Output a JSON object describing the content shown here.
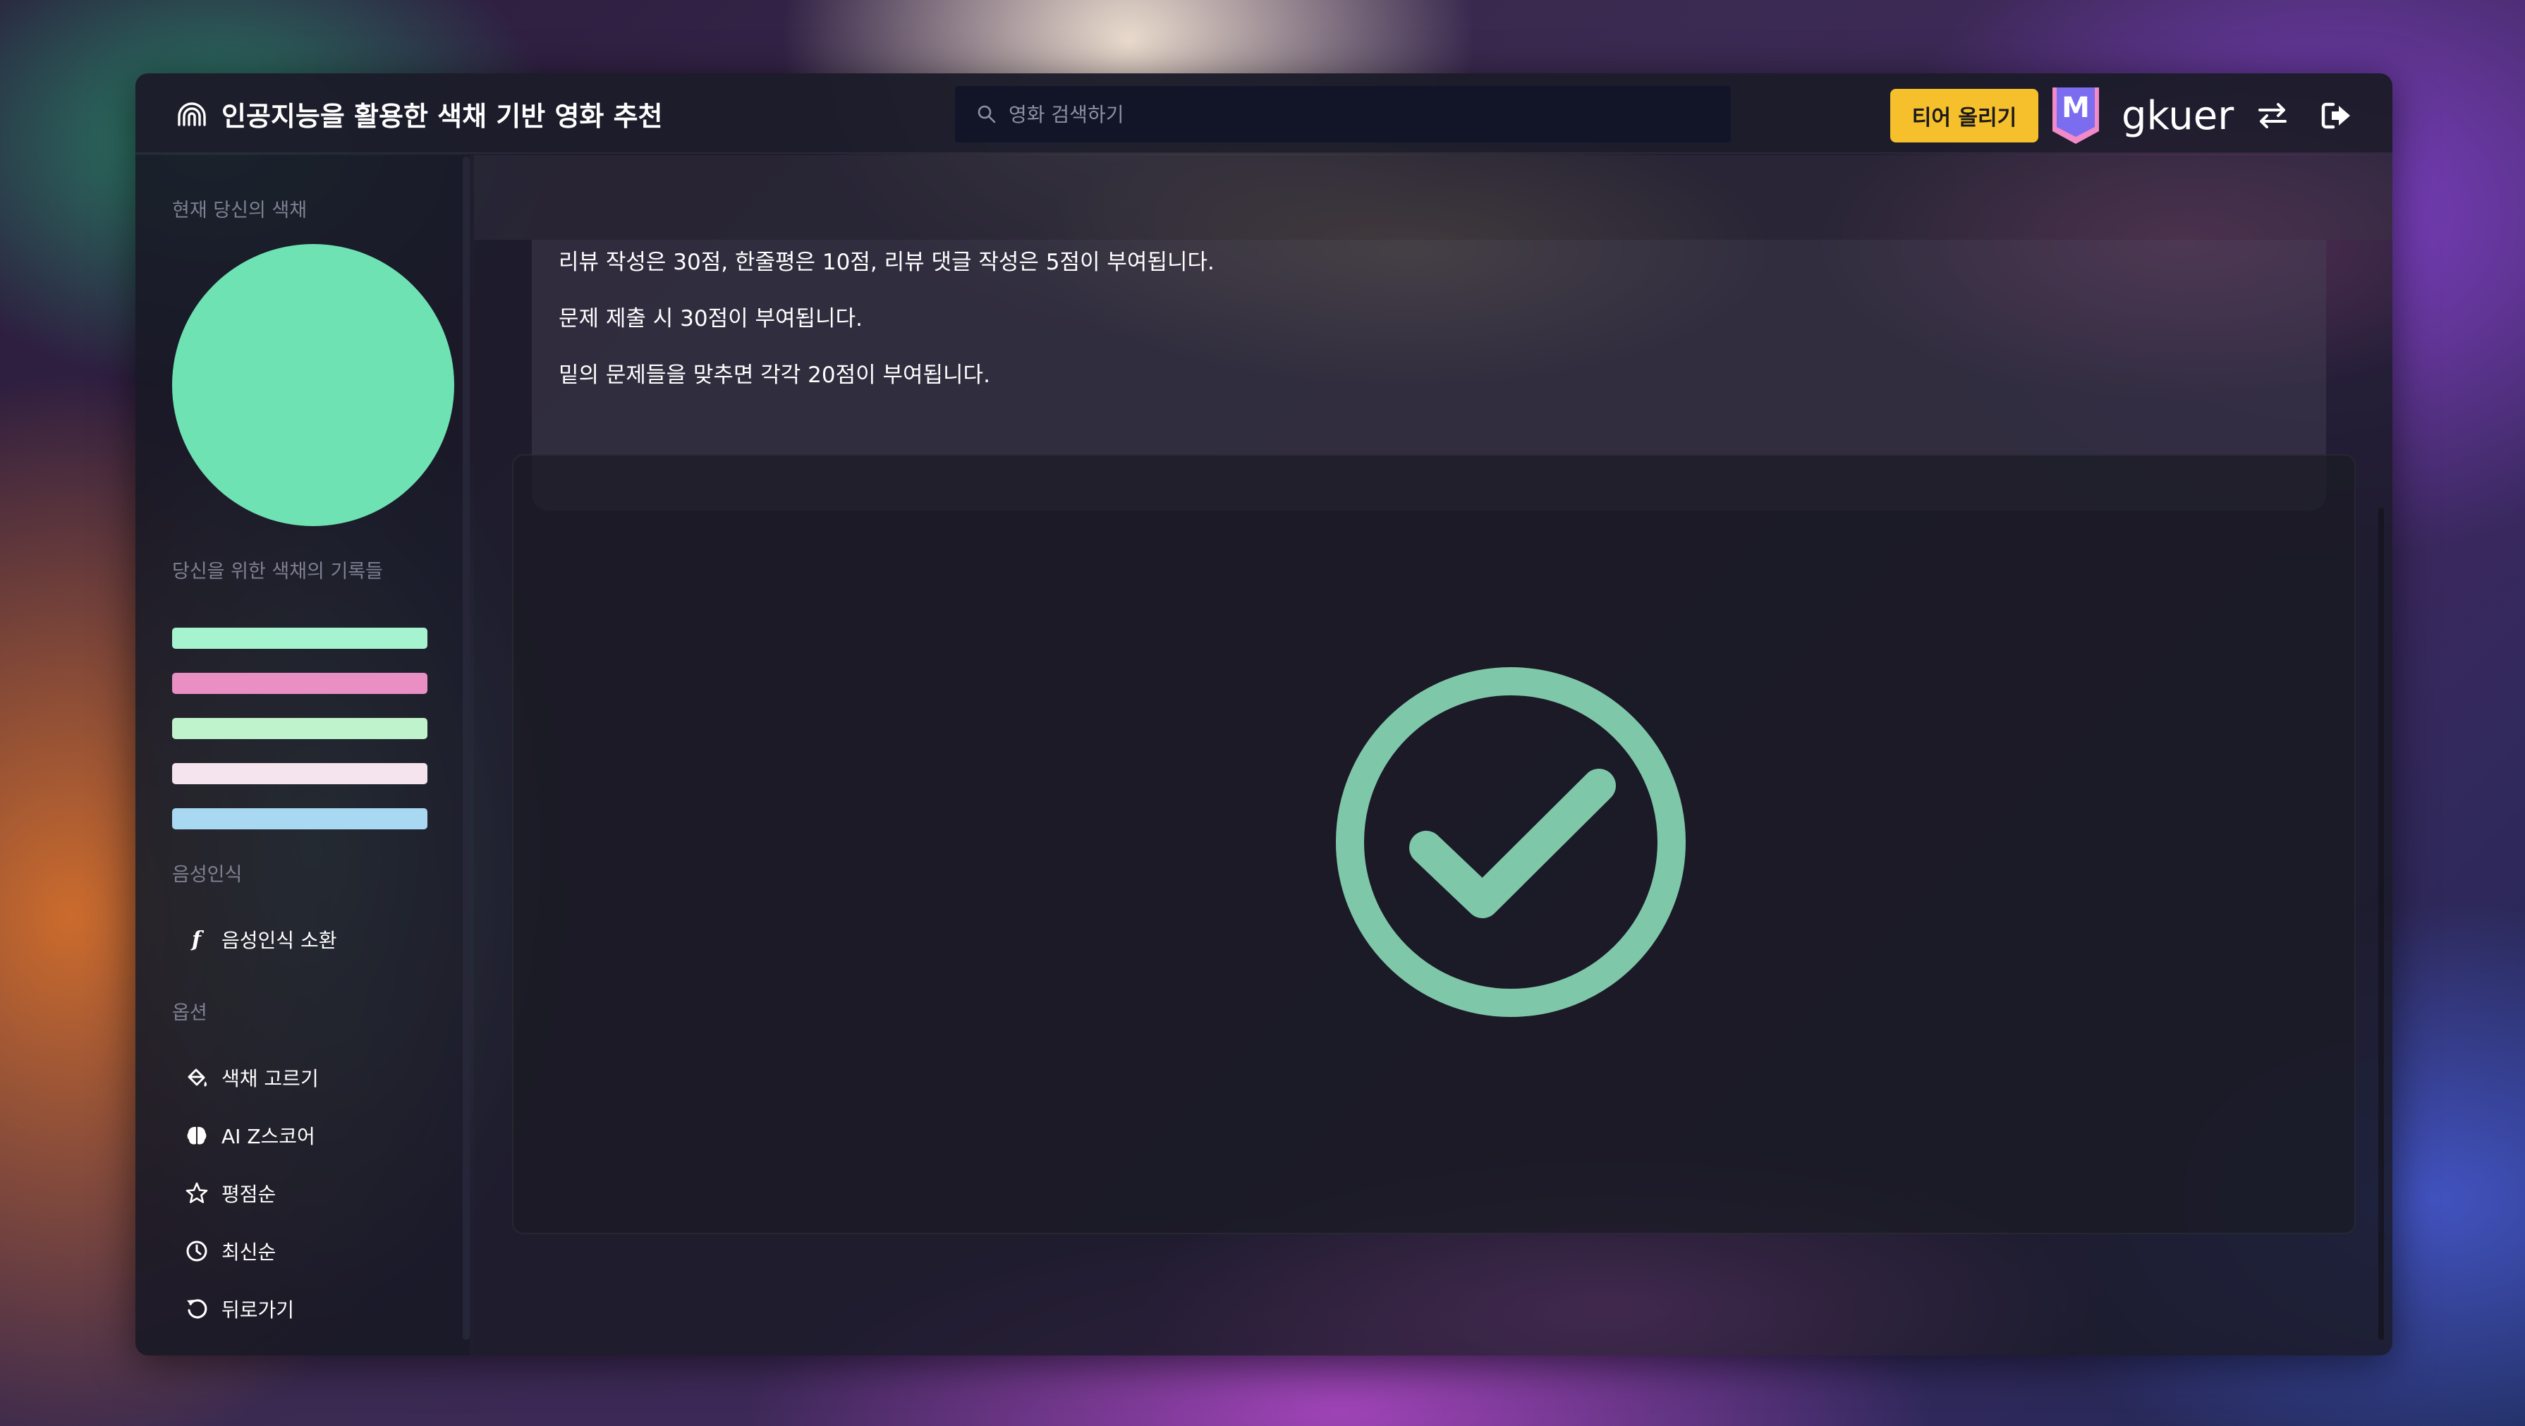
{
  "header": {
    "title": "인공지능을 활용한 색채 기반 영화 추천",
    "search_placeholder": "영화 검색하기",
    "tier_button": "티어 올리기",
    "badge_letter": "M",
    "username": "gkuer",
    "icons": [
      "fingerprint-icon",
      "search-icon",
      "swap-icon",
      "logout-icon"
    ]
  },
  "sidebar": {
    "current_color_label": "현재 당신의 색채",
    "current_color": "#6fe2b4",
    "history_label": "당신을 위한 색채의 기록들",
    "history_colors": [
      "#a6f3d0",
      "#e98fc4",
      "#bff3cc",
      "#f5e3ee",
      "#a8d8f2"
    ],
    "voice_label": "음성인식",
    "voice_item": "음성인식 소환",
    "options_label": "옵션",
    "options": [
      {
        "label": "색채 고르기",
        "icon": "paint-bucket-icon"
      },
      {
        "label": "AI Z스코어",
        "icon": "brain-icon"
      },
      {
        "label": "평점순",
        "icon": "star-icon"
      },
      {
        "label": "최신순",
        "icon": "clock-icon"
      },
      {
        "label": "뒤로가기",
        "icon": "undo-icon"
      }
    ]
  },
  "main": {
    "info_lines": [
      "리뷰 작성은 30점, 한줄평은 10점, 리뷰 댓글 작성은 5점이 부여됩니다.",
      "문제 제출 시 30점이 부여됩니다.",
      "밑의 문제들을 맞추면 각각 20점이 부여됩니다."
    ],
    "result_icon": "check-circle-icon",
    "result_color": "#7fc7a9"
  },
  "colors": {
    "accent_yellow": "#f6c02c",
    "badge_purple": "#7b6cf0",
    "badge_pink": "#f08ac8"
  }
}
